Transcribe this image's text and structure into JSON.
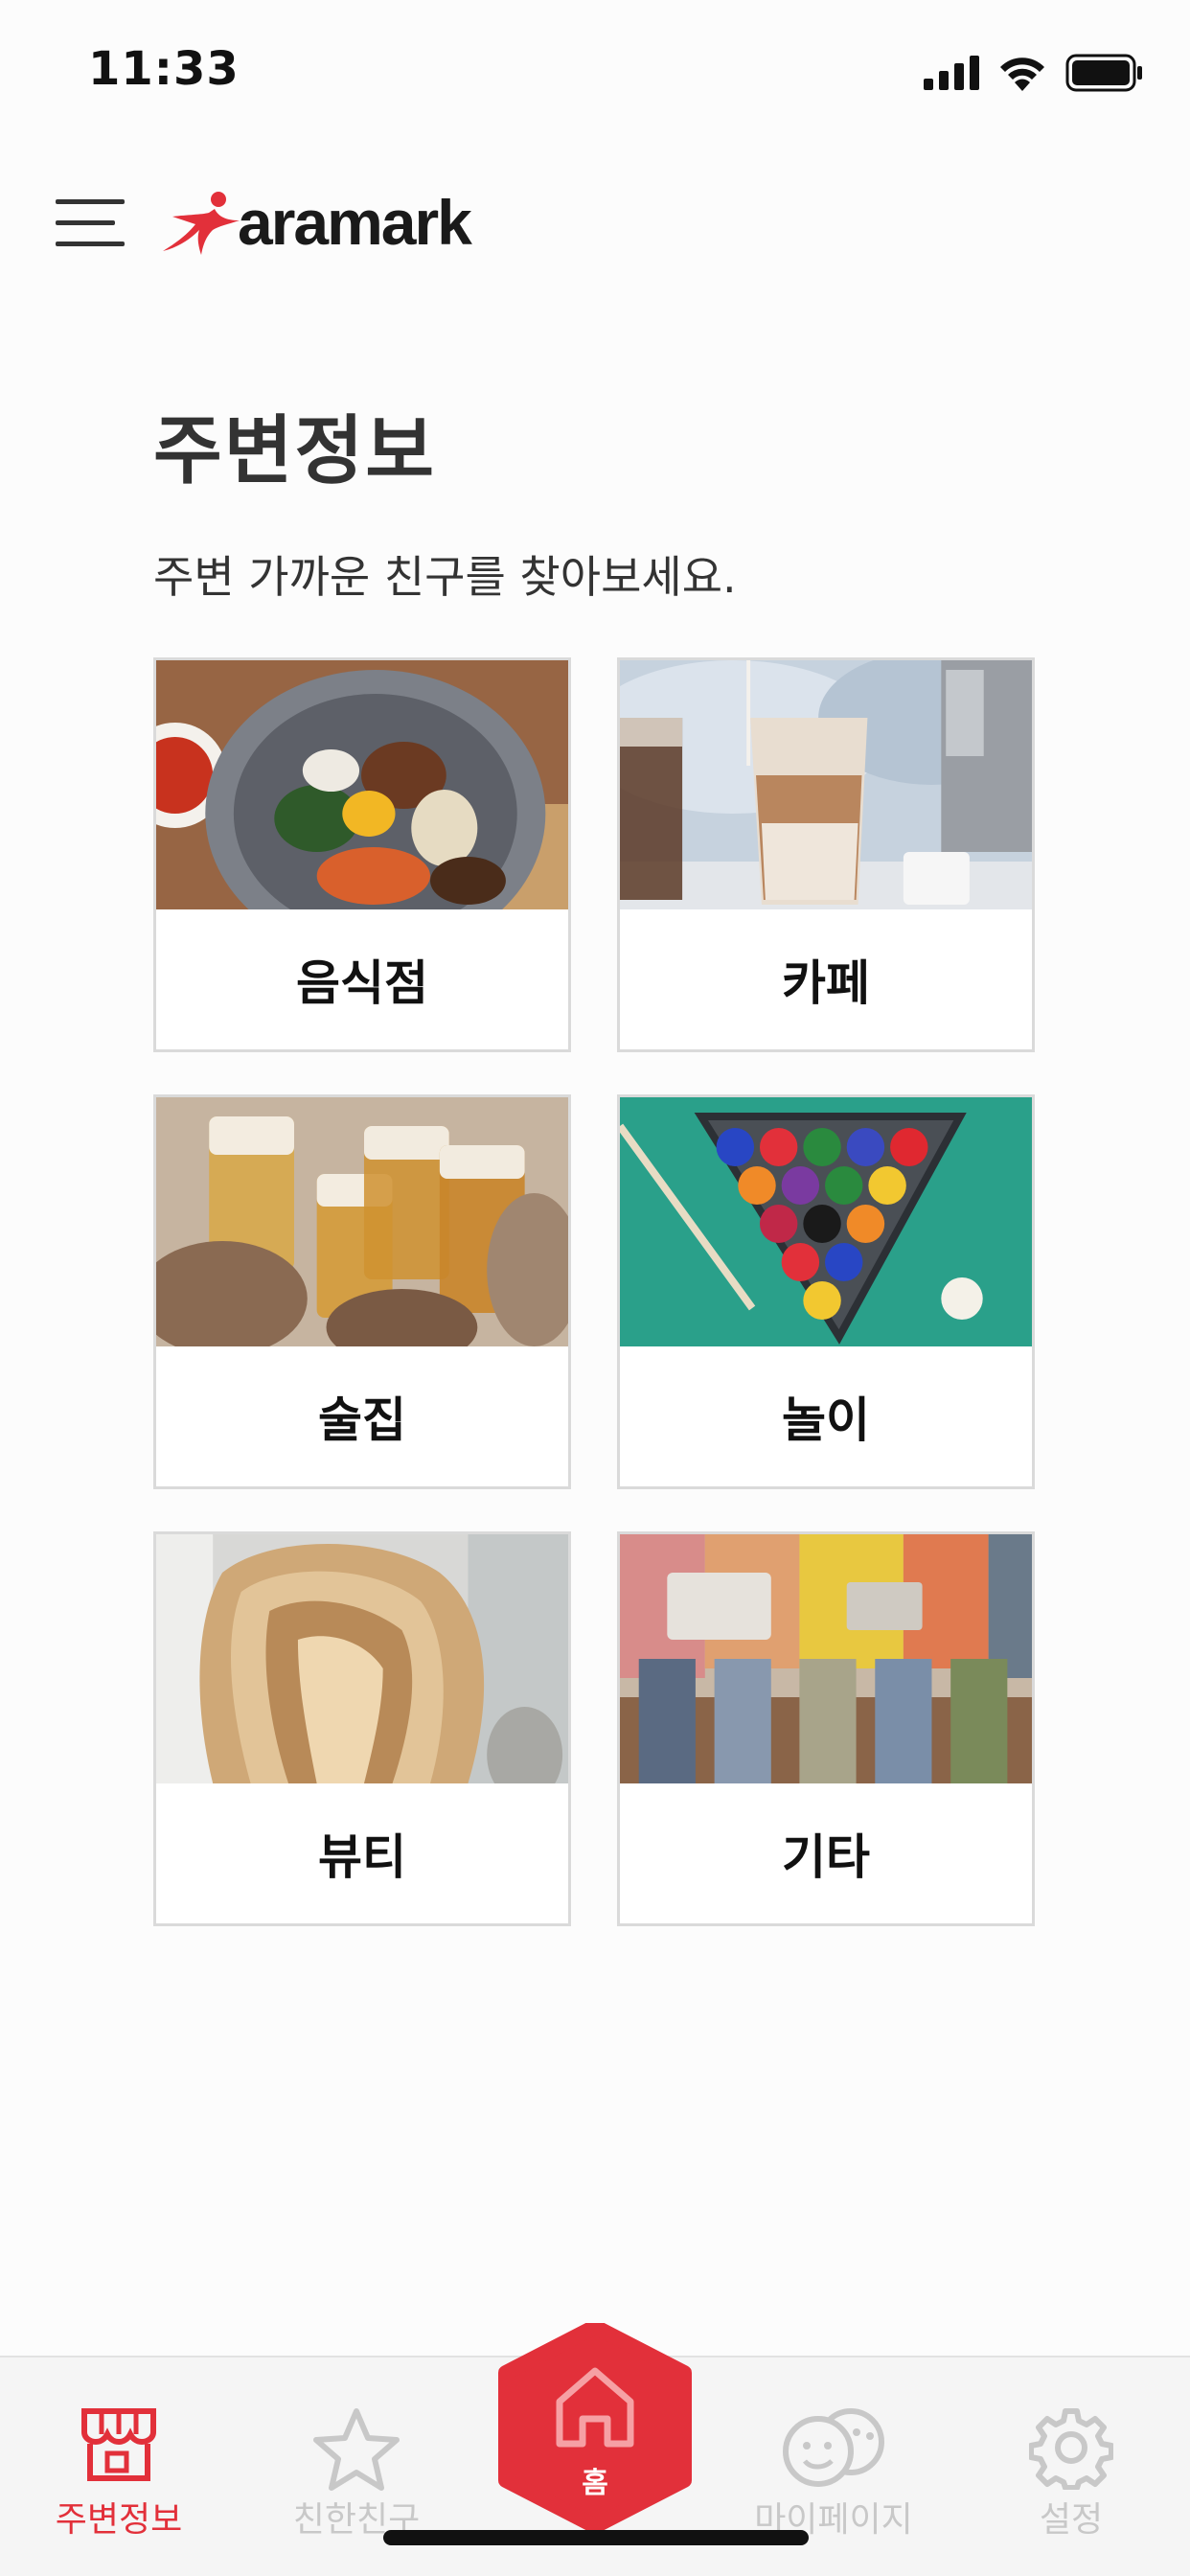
{
  "status_bar": {
    "time": "11:33"
  },
  "header": {
    "logo_text": "aramark",
    "brand_color": "#e2303a"
  },
  "page": {
    "title": "주변정보",
    "subtitle": "주변 가까운 친구를 찾아보세요."
  },
  "categories": [
    {
      "label": "음식점",
      "image": "bibimbap-photo"
    },
    {
      "label": "카페",
      "image": "iced-latte-photo"
    },
    {
      "label": "술집",
      "image": "beer-toast-photo"
    },
    {
      "label": "놀이",
      "image": "billiards-photo"
    },
    {
      "label": "뷰티",
      "image": "hair-photo"
    },
    {
      "label": "기타",
      "image": "friends-photo"
    }
  ],
  "bottom_nav": {
    "items": [
      {
        "label": "주변정보",
        "icon": "storefront-icon",
        "active": true
      },
      {
        "label": "친한친구",
        "icon": "star-icon",
        "active": false
      },
      {
        "label": "홈",
        "icon": "home-icon",
        "active": false
      },
      {
        "label": "마이페이지",
        "icon": "faces-icon",
        "active": false
      },
      {
        "label": "설정",
        "icon": "gear-icon",
        "active": false
      }
    ]
  }
}
